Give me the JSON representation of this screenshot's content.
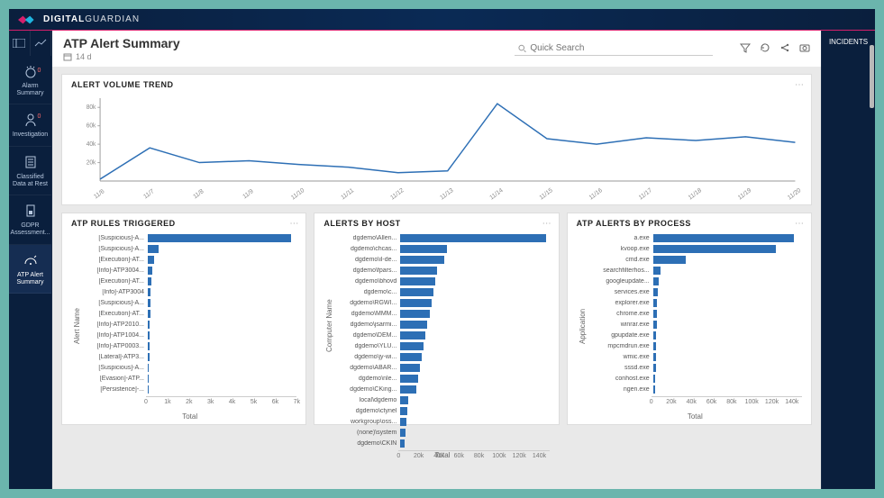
{
  "brand": {
    "bold": "DIGITAL",
    "light": "GUARDIAN"
  },
  "rightbar": {
    "label": "INCIDENTS"
  },
  "sidebar": [
    {
      "id": "alarm-summary",
      "label": "Alarm Summary",
      "badge": "0"
    },
    {
      "id": "investigation",
      "label": "Investigation",
      "badge": "0"
    },
    {
      "id": "classified-data",
      "label": "Classified Data at Rest",
      "badge": ""
    },
    {
      "id": "gdpr",
      "label": "GDPR Assessment...",
      "badge": ""
    },
    {
      "id": "atp-alert-summary",
      "label": "ATP Alert Summary",
      "badge": ""
    }
  ],
  "page": {
    "title": "ATP Alert Summary",
    "range": "14 d"
  },
  "search": {
    "placeholder": "Quick Search"
  },
  "panels": {
    "trend_title": "ALERT VOLUME TREND",
    "rules_title": "ATP RULES TRIGGERED",
    "hosts_title": "ALERTS BY HOST",
    "process_title": "ATP ALERTS BY PROCESS"
  },
  "axis_labels": {
    "rules_y": "Alert Name",
    "hosts_y": "Computer Name",
    "process_y": "Application",
    "x": "Total"
  },
  "chart_data": {
    "trend": {
      "type": "line",
      "x": [
        "11/6",
        "11/7",
        "11/8",
        "11/9",
        "11/10",
        "11/11",
        "11/12",
        "11/13",
        "11/14",
        "11/15",
        "11/16",
        "11/17",
        "11/18",
        "11/19",
        "11/20"
      ],
      "values": [
        2000,
        36000,
        20000,
        22000,
        18000,
        15000,
        9000,
        11000,
        84000,
        46000,
        40000,
        47000,
        44000,
        48000,
        42000
      ],
      "yticks": [
        20000,
        40000,
        60000,
        80000
      ],
      "ytick_labels": [
        "20k",
        "40k",
        "60k",
        "80k"
      ],
      "ylim": [
        0,
        90000
      ]
    },
    "rules": {
      "type": "bar",
      "categories": [
        "[Suspicious]-A...",
        "[Suspicious]-A...",
        "[Execution]-AT...",
        "[Info]-ATP3004...",
        "[Execution]-AT...",
        "[Info]-ATP3004",
        "[Suspicious]-A...",
        "[Execution]-AT...",
        "[Info]-ATP2010...",
        "[Info]-ATP1004...",
        "[Info]-ATP0003...",
        "[Lateral]-ATP3...",
        "[Suspicious]-A...",
        "[Evasion]-ATP...",
        "[Persistence]-..."
      ],
      "values": [
        6900,
        500,
        300,
        200,
        180,
        150,
        120,
        110,
        100,
        90,
        80,
        70,
        60,
        50,
        40
      ],
      "xmax": 7000,
      "xticks": [
        0,
        1000,
        2000,
        3000,
        4000,
        5000,
        6000,
        7000
      ],
      "xtick_labels": [
        "0",
        "1k",
        "2k",
        "3k",
        "4k",
        "5k",
        "6k",
        "7k"
      ]
    },
    "hosts": {
      "type": "bar",
      "categories": [
        "dgdemo\\Allen...",
        "dgdemo\\chcas...",
        "dgdemo\\il-de...",
        "dgdemo\\fpars...",
        "dgdemo\\bhovd",
        "dgdemo\\c...",
        "dgdemo\\RGWI...",
        "dgdemo\\MMM...",
        "dgdemo\\jsarmi...",
        "dgdemo\\DEM...",
        "dgdemo\\YLU...",
        "dgdemo\\jy-wi...",
        "dgdemo\\ABAR...",
        "dgdemo\\nle...",
        "dgdemo\\CKing...",
        "local\\dgdemo",
        "dgdemo\\ctynel",
        "workgroup\\oss...",
        "(none)\\system",
        "dgdemo\\CKIN"
      ],
      "values": [
        150000,
        48000,
        45000,
        38000,
        36000,
        34000,
        32000,
        30000,
        28000,
        26000,
        24000,
        22000,
        20000,
        18000,
        16000,
        8000,
        7000,
        6000,
        5000,
        4000
      ],
      "xmax": 150000,
      "xticks": [
        0,
        20000,
        40000,
        60000,
        80000,
        100000,
        120000,
        140000
      ],
      "xtick_labels": [
        "0",
        "20k",
        "40k",
        "60k",
        "80k",
        "100k",
        "120k",
        "140k"
      ]
    },
    "process": {
      "type": "bar",
      "categories": [
        "a.exe",
        "kvoop.exe",
        "cmd.exe",
        "searchfilterhos...",
        "googleupdate...",
        "services.exe",
        "explorer.exe",
        "chrome.exe",
        "winrar.exe",
        "gpupdate.exe",
        "mpcmdrun.exe",
        "wmic.exe",
        "sssd.exe",
        "conhost.exe",
        "ngen.exe"
      ],
      "values": [
        145000,
        127000,
        34000,
        8000,
        6000,
        5000,
        4500,
        4000,
        3800,
        3500,
        3200,
        3000,
        2800,
        2500,
        2200
      ],
      "xmax": 150000,
      "xticks": [
        0,
        20000,
        40000,
        60000,
        80000,
        100000,
        120000,
        140000
      ],
      "xtick_labels": [
        "0",
        "20k",
        "40k",
        "60k",
        "80k",
        "100k",
        "120k",
        "140k"
      ]
    }
  }
}
